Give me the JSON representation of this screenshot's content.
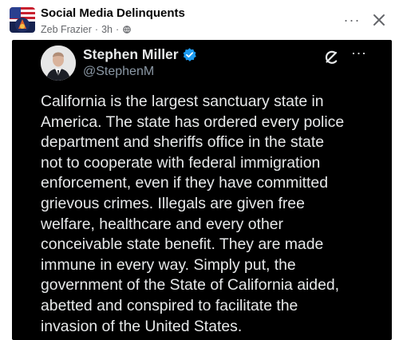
{
  "post": {
    "group_name": "Social Media Delinquents",
    "author": "Zeb Frazier",
    "time": "3h",
    "separator": "·",
    "more_label": "···",
    "icons": {
      "globe": "globe-icon",
      "close": "close-icon",
      "group_avatar": "group-avatar-image"
    }
  },
  "tweet": {
    "name": "Stephen Miller",
    "handle": "@StephenM",
    "more_label": "···",
    "icons": {
      "verified": "verified-badge-icon",
      "grok": "grok-icon"
    },
    "body": "California is the largest sanctuary state in\nAmerica. The state has ordered every police\ndepartment and sheriffs office in the state\nnot to cooperate with federal immigration\nenforcement, even if they have committed\ngrievous crimes. Illegals are given free\nwelfare, healthcare and every other\nconceivable state benefit. They are made\nimmune in every way. Simply put, the\ngovernment of the State of California aided,\nabetted and conspired to facilitate the\ninvasion of the United States."
  },
  "colors": {
    "tweet_background": "#000000",
    "tweet_text": "#e7e9ea",
    "handle": "#8b98a5",
    "verified": "#1d9bf0",
    "fb_secondary": "#65676b"
  }
}
